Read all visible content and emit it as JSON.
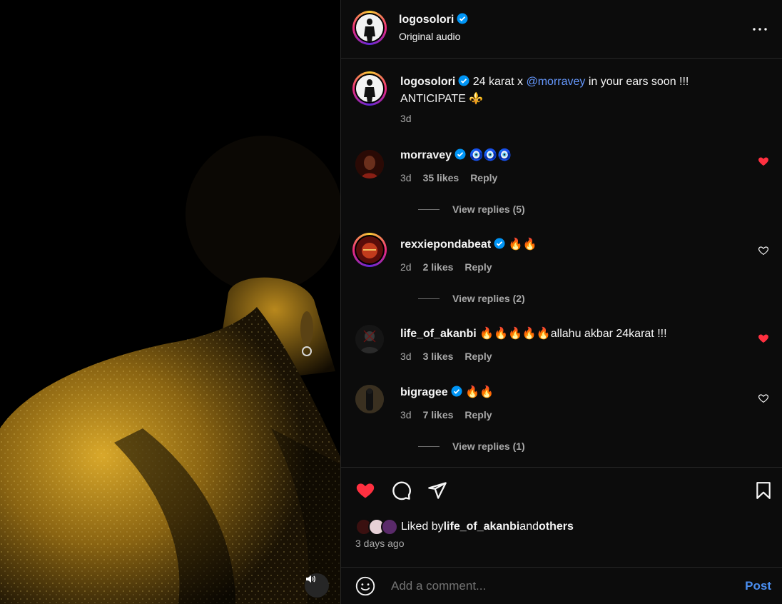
{
  "post": {
    "author": "logosolori",
    "audio": "Original audio",
    "caption_text_1": "24 karat x ",
    "caption_mention": "@morravey",
    "caption_text_2": " in your ears soon !!!",
    "caption_line_2": "ANTICIPATE ⚜️",
    "caption_time": "3d"
  },
  "comments": [
    {
      "user": "morravey",
      "verified": true,
      "text": "🧿🧿🧿",
      "time": "3d",
      "likes": "35 likes",
      "reply": "Reply",
      "liked": true,
      "view_replies": "View replies (5)"
    },
    {
      "user": "rexxiepondabeat",
      "verified": true,
      "text": "🔥🔥",
      "time": "2d",
      "likes": "2 likes",
      "reply": "Reply",
      "liked": false,
      "view_replies": "View replies (2)"
    },
    {
      "user": "life_of_akanbi",
      "verified": false,
      "text": "🔥🔥🔥🔥🔥allahu akbar 24karat !!!",
      "time": "3d",
      "likes": "3 likes",
      "reply": "Reply",
      "liked": true,
      "view_replies": ""
    },
    {
      "user": "bigragee",
      "verified": true,
      "text": "🔥🔥",
      "time": "3d",
      "likes": "7 likes",
      "reply": "Reply",
      "liked": false,
      "view_replies": "View replies (1)"
    }
  ],
  "actions": {
    "liked_by_prefix": "Liked by ",
    "liked_by_user": "life_of_akanbi",
    "liked_by_and": " and ",
    "liked_by_others": "others",
    "time_ago": "3 days ago",
    "post_liked": true
  },
  "add_comment": {
    "placeholder": "Add a comment...",
    "post_label": "Post"
  },
  "colors": {
    "background": "#0c0c0c",
    "like_red": "#ff3040",
    "link_blue": "#6699ff",
    "post_blue": "#4a8ef0",
    "verified_blue": "#0095f6"
  },
  "icons": {
    "more": "more-options-icon",
    "volume": "volume-icon",
    "like": "heart-icon",
    "comment": "comment-icon",
    "share": "share-icon",
    "save": "bookmark-icon",
    "emoji": "emoji-icon"
  }
}
